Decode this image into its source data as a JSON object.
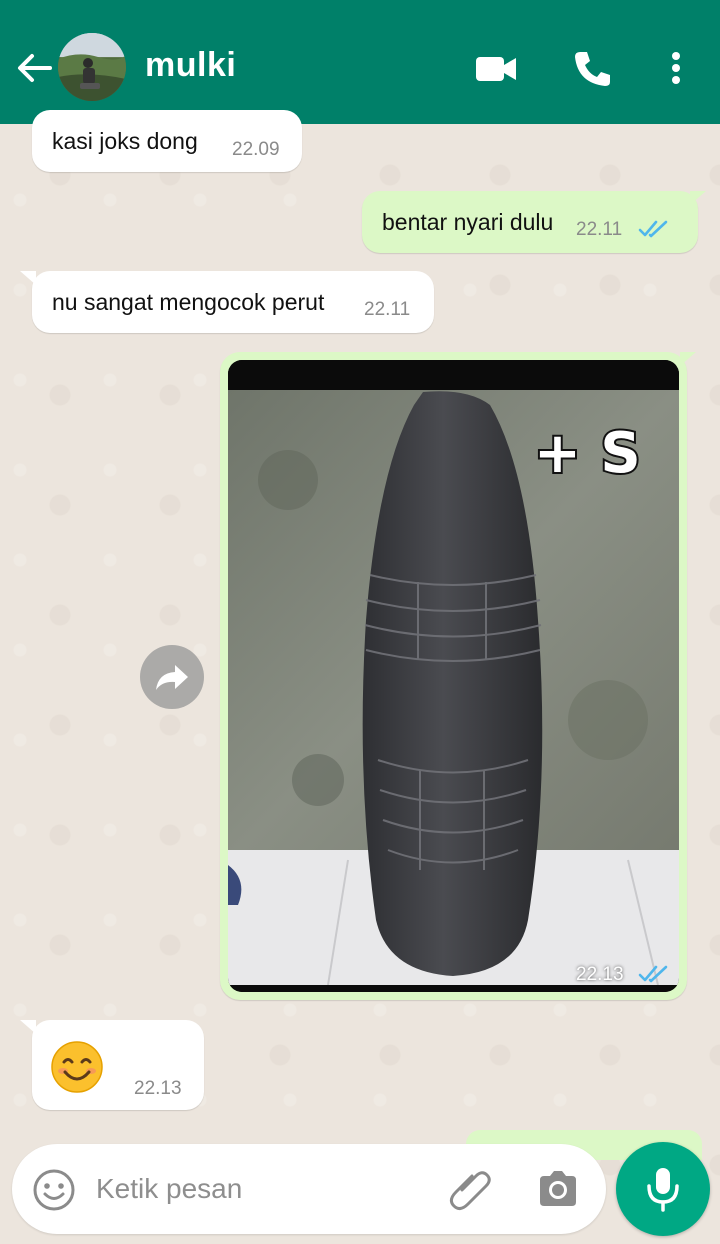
{
  "header": {
    "contact_name": "mulki",
    "color": "#008069"
  },
  "messages": [
    {
      "direction": "in",
      "text": "kasi joks dong",
      "time": "22.09"
    },
    {
      "direction": "out",
      "text": "bentar nyari dulu",
      "time": "22.11",
      "status": "read"
    },
    {
      "direction": "in",
      "text": "nu sangat mengocok perut",
      "time": "22.11"
    },
    {
      "direction": "out",
      "type": "image",
      "overlay_text": "+ S",
      "time": "22.13",
      "status": "read"
    },
    {
      "direction": "in",
      "emoji": "😊",
      "time": "22.13"
    }
  ],
  "composer": {
    "placeholder": "Ketik pesan"
  },
  "icons": {
    "back": "arrow-left-icon",
    "video": "video-camera-icon",
    "call": "phone-icon",
    "menu": "more-vertical-icon",
    "forward": "forward-icon",
    "emoji": "smiley-icon",
    "attach": "paperclip-icon",
    "camera": "camera-icon",
    "mic": "microphone-icon"
  },
  "colors": {
    "incoming_bubble": "#ffffff",
    "outgoing_bubble": "#dcf8c6",
    "read_ticks": "#4fb6ec",
    "mic_button": "#00a884"
  }
}
